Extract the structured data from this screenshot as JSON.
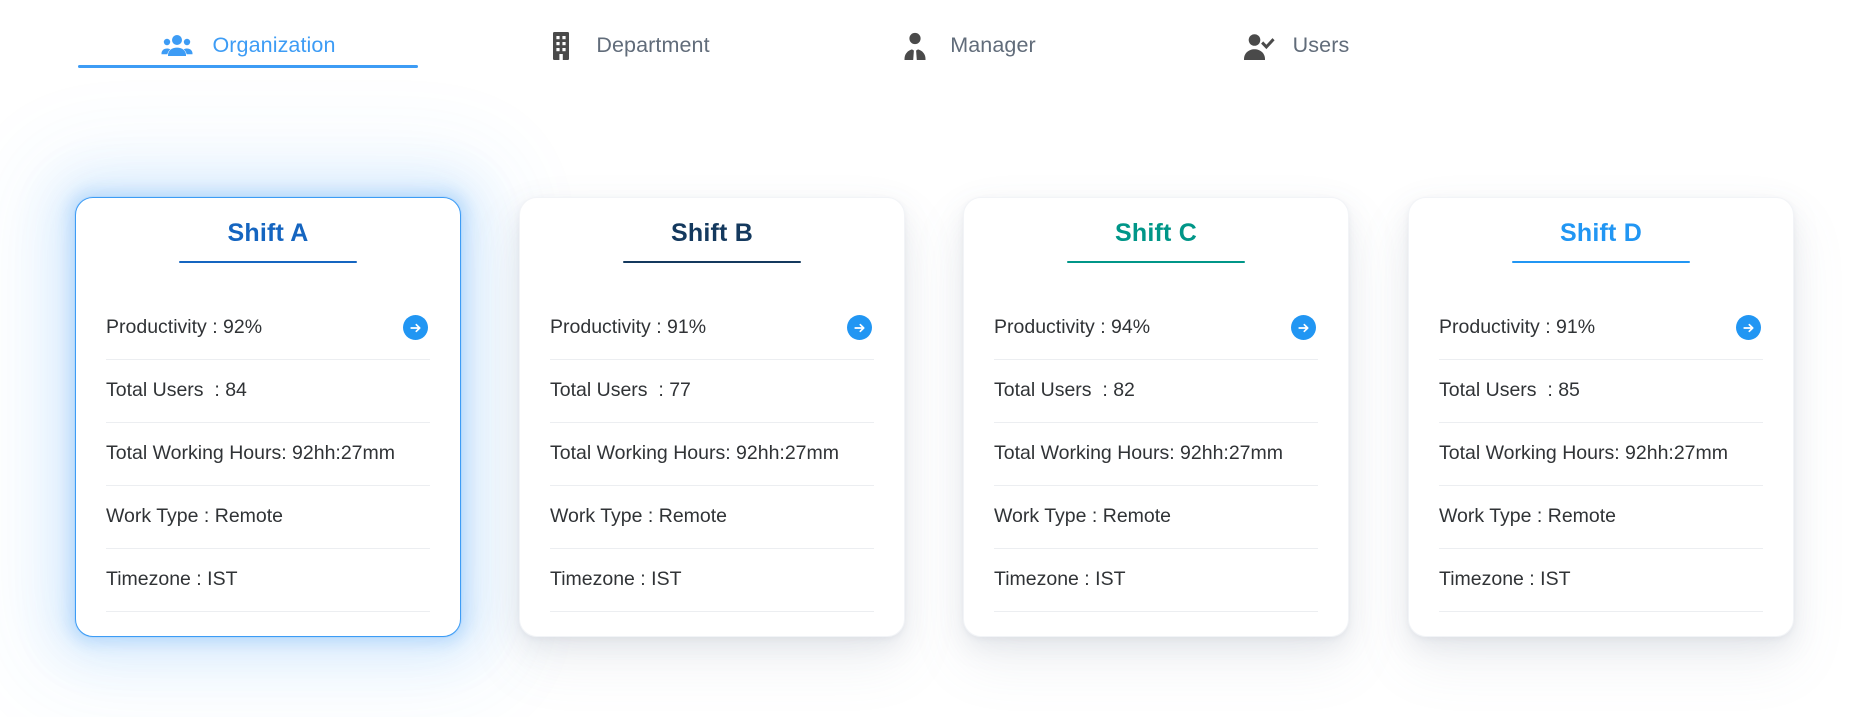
{
  "tabs": [
    {
      "id": "organization",
      "label": "Organization",
      "icon": "people-group-icon",
      "active": true,
      "icon_color": "#3d9cf5"
    },
    {
      "id": "department",
      "label": "Department",
      "icon": "building-icon",
      "active": false,
      "icon_color": "#4a4a4a"
    },
    {
      "id": "manager",
      "label": "Manager",
      "icon": "manager-person-icon",
      "active": false,
      "icon_color": "#4a4a4a"
    },
    {
      "id": "users",
      "label": "Users",
      "icon": "user-check-icon",
      "active": false,
      "icon_color": "#4a4a4a"
    }
  ],
  "colors": {
    "active_tab": "#3d9cf5",
    "inactive_tab_label": "#616c7a",
    "arrow_button": "#2196f3",
    "row_text": "#303336",
    "divider": "#eceef1"
  },
  "cards": [
    {
      "id": "shift-a",
      "title": "Shift A",
      "title_color": "#1565c0",
      "rule_color": "#1565c0",
      "selected": true,
      "arrow_icon": "arrow-right-circle-icon",
      "rows": [
        {
          "key": "productivity",
          "text": "Productivity : 92%",
          "has_arrow": true
        },
        {
          "key": "total-users",
          "text": "Total Users  : 84",
          "has_arrow": false
        },
        {
          "key": "total-working-hours",
          "text": "Total Working Hours: 92hh:27mm",
          "has_arrow": false
        },
        {
          "key": "work-type",
          "text": "Work Type : Remote",
          "has_arrow": false
        },
        {
          "key": "timezone",
          "text": "Timezone : IST",
          "has_arrow": false
        }
      ]
    },
    {
      "id": "shift-b",
      "title": "Shift B",
      "title_color": "#14395e",
      "rule_color": "#14395e",
      "selected": false,
      "arrow_icon": "arrow-right-circle-icon",
      "rows": [
        {
          "key": "productivity",
          "text": "Productivity : 91%",
          "has_arrow": true
        },
        {
          "key": "total-users",
          "text": "Total Users  : 77",
          "has_arrow": false
        },
        {
          "key": "total-working-hours",
          "text": "Total Working Hours: 92hh:27mm",
          "has_arrow": false
        },
        {
          "key": "work-type",
          "text": "Work Type : Remote",
          "has_arrow": false
        },
        {
          "key": "timezone",
          "text": "Timezone : IST",
          "has_arrow": false
        }
      ]
    },
    {
      "id": "shift-c",
      "title": "Shift C",
      "title_color": "#009688",
      "rule_color": "#009688",
      "selected": false,
      "arrow_icon": "arrow-right-circle-icon",
      "rows": [
        {
          "key": "productivity",
          "text": "Productivity : 94%",
          "has_arrow": true
        },
        {
          "key": "total-users",
          "text": "Total Users  : 82",
          "has_arrow": false
        },
        {
          "key": "total-working-hours",
          "text": "Total Working Hours: 92hh:27mm",
          "has_arrow": false
        },
        {
          "key": "work-type",
          "text": "Work Type : Remote",
          "has_arrow": false
        },
        {
          "key": "timezone",
          "text": "Timezone : IST",
          "has_arrow": false
        }
      ]
    },
    {
      "id": "shift-d",
      "title": "Shift D",
      "title_color": "#2196f3",
      "rule_color": "#2196f3",
      "selected": false,
      "arrow_icon": "arrow-right-circle-icon",
      "rows": [
        {
          "key": "productivity",
          "text": "Productivity : 91%",
          "has_arrow": true
        },
        {
          "key": "total-users",
          "text": "Total Users  : 85",
          "has_arrow": false
        },
        {
          "key": "total-working-hours",
          "text": "Total Working Hours: 92hh:27mm",
          "has_arrow": false
        },
        {
          "key": "work-type",
          "text": "Work Type : Remote",
          "has_arrow": false
        },
        {
          "key": "timezone",
          "text": "Timezone : IST",
          "has_arrow": false
        }
      ]
    }
  ]
}
